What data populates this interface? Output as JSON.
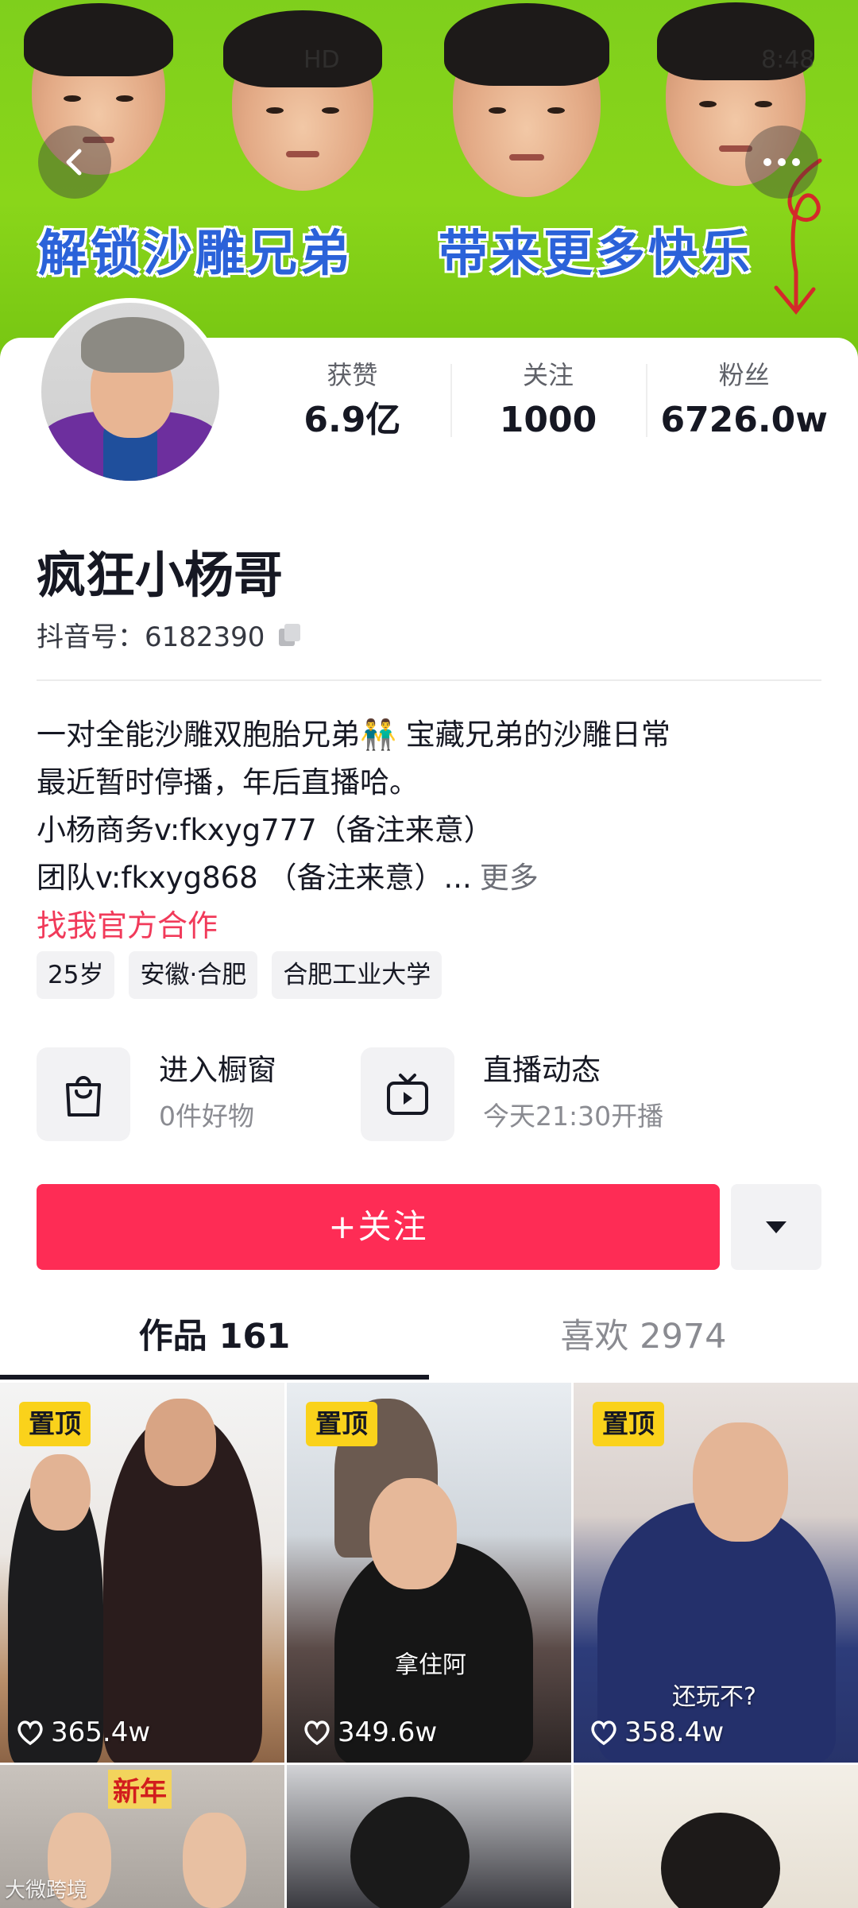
{
  "banner": {
    "text_left": "解锁沙雕兄弟",
    "text_right": "带来更多快乐",
    "status_text": "HD",
    "status_time": "8:48"
  },
  "nav": {
    "back_icon": "chevron-left-icon",
    "more_icon": "more-dots-icon"
  },
  "profile": {
    "name": "疯狂小杨哥",
    "id_label": "抖音号：",
    "id_value": "6182390",
    "stats": [
      {
        "label": "获赞",
        "value": "6.9亿"
      },
      {
        "label": "关注",
        "value": "1000"
      },
      {
        "label": "粉丝",
        "value": "6726.0w"
      }
    ],
    "bio": [
      "一对全能沙雕双胞胎兄弟👬 宝藏兄弟的沙雕日常",
      "最近暂时停播，年后直播哈。",
      "小杨商务v:fkxyg777（备注来意）",
      "团队v:fkxyg868 （备注来意）..."
    ],
    "bio_more": "更多",
    "business_link": "找我官方合作",
    "tags": [
      "25岁",
      "安徽·合肥",
      "合肥工业大学"
    ]
  },
  "quick_links": [
    {
      "icon": "shopping-bag-icon",
      "title": "进入橱窗",
      "subtitle": "0件好物"
    },
    {
      "icon": "live-tv-icon",
      "title": "直播动态",
      "subtitle": "今天21:30开播"
    }
  ],
  "actions": {
    "follow_label": "+关注",
    "dropdown_icon": "caret-down-icon"
  },
  "tabs": [
    {
      "label": "作品 161",
      "active": true
    },
    {
      "label": "喜欢 2974",
      "active": false
    }
  ],
  "videos": [
    {
      "pinned": true,
      "pin_label": "置顶",
      "likes": "365.4w",
      "caption": ""
    },
    {
      "pinned": true,
      "pin_label": "置顶",
      "likes": "349.6w",
      "caption": "拿住阿"
    },
    {
      "pinned": true,
      "pin_label": "置顶",
      "likes": "358.4w",
      "caption": "还玩不?"
    },
    {
      "pinned": false,
      "likes": "",
      "caption": "新年"
    },
    {
      "pinned": false,
      "likes": "",
      "caption": ""
    },
    {
      "pinned": false,
      "likes": "",
      "caption": ""
    }
  ],
  "watermark": "大微跨境",
  "colors": {
    "accent": "#fe2c55",
    "link": "#f13a5a",
    "pin": "#fad21b",
    "banner_green": "#86d41a",
    "banner_text": "#2b62d9"
  }
}
